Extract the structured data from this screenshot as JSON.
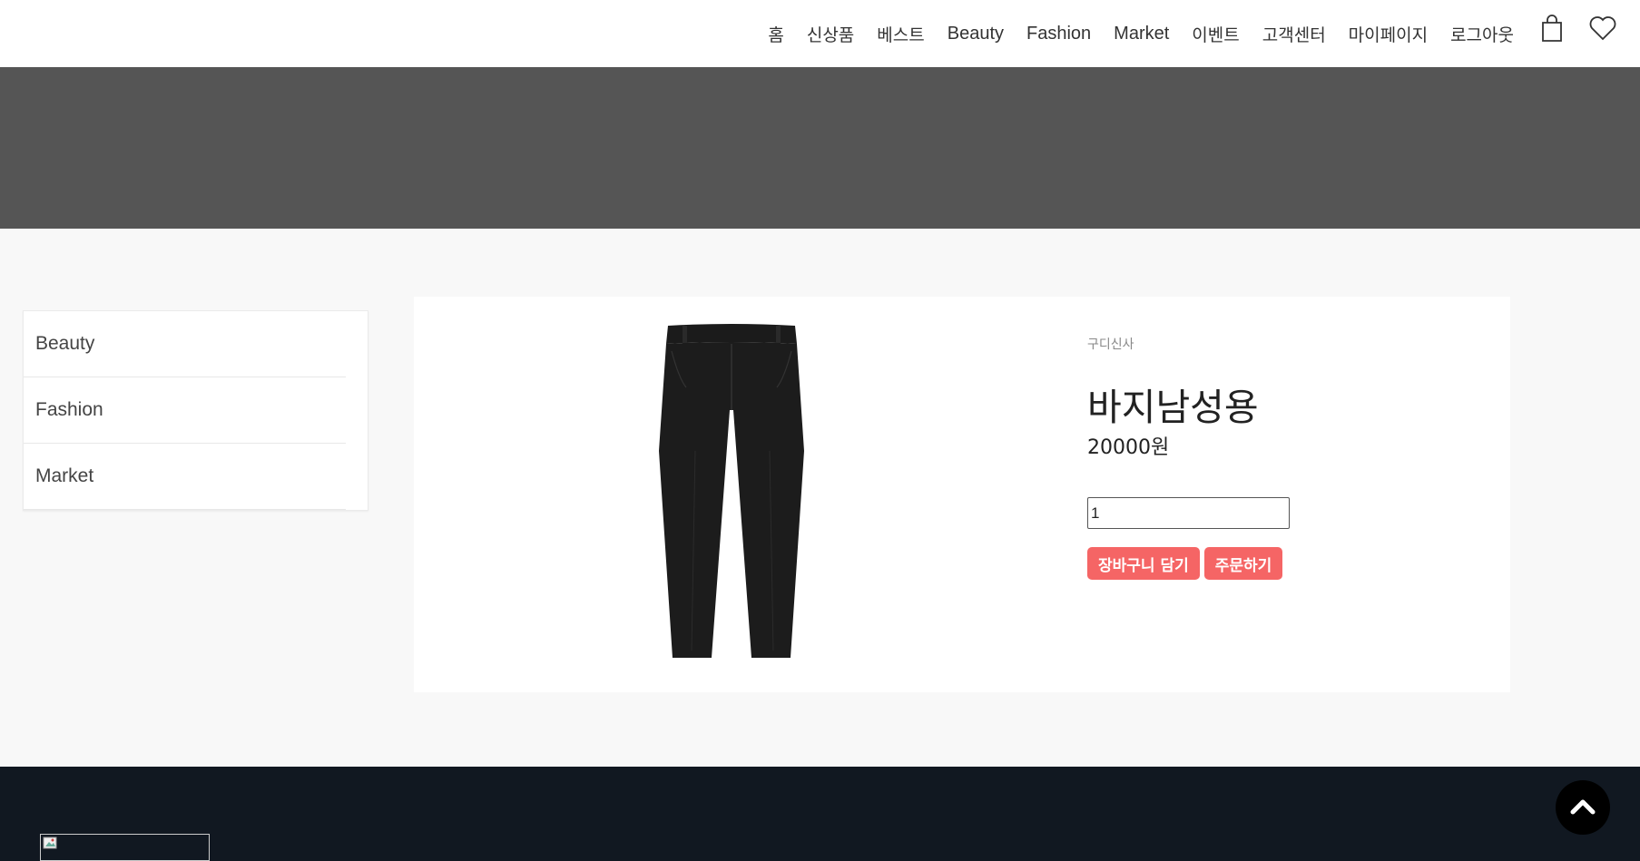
{
  "header": {
    "nav": [
      {
        "label": "홈"
      },
      {
        "label": "신상품"
      },
      {
        "label": "베스트"
      },
      {
        "label": "Beauty"
      },
      {
        "label": "Fashion"
      },
      {
        "label": "Market"
      },
      {
        "label": "이벤트"
      },
      {
        "label": "고객센터"
      },
      {
        "label": "마이페이지"
      },
      {
        "label": "로그아웃"
      }
    ],
    "icons": [
      "shopping-bag-icon",
      "heart-icon"
    ]
  },
  "sidebar": {
    "items": [
      {
        "label": "Beauty"
      },
      {
        "label": "Fashion"
      },
      {
        "label": "Market"
      }
    ]
  },
  "product": {
    "brand": "구디신사",
    "name": "바지남성용",
    "price": "20000원",
    "quantity": "1",
    "cart_button": "장바구니 담기",
    "order_button": "주문하기",
    "image": "black-pants"
  },
  "colors": {
    "accent": "#f56565",
    "hero": "#555555",
    "footer": "#111821",
    "page_bg": "#f8f8f8"
  },
  "footer": {
    "logo": "broken-image-icon",
    "scroll_top": "chevron-up-icon"
  }
}
